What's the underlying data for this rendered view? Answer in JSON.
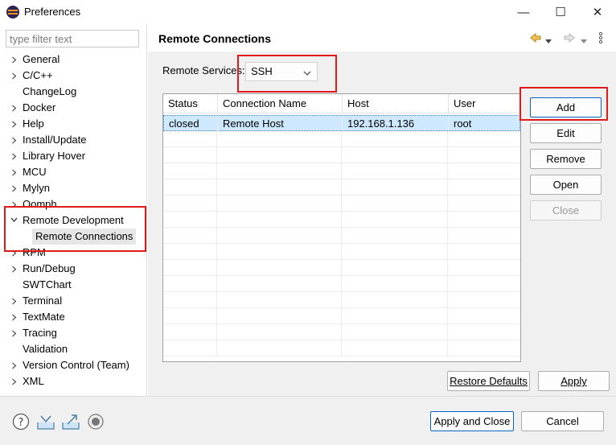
{
  "window": {
    "title": "Preferences",
    "minimize": "—",
    "maximize": "☐",
    "close": "✕"
  },
  "filter": {
    "placeholder": "type filter text"
  },
  "tree": [
    {
      "label": "General",
      "expandable": true
    },
    {
      "label": "C/C++",
      "expandable": true
    },
    {
      "label": "ChangeLog",
      "expandable": false
    },
    {
      "label": "Docker",
      "expandable": true
    },
    {
      "label": "Help",
      "expandable": true
    },
    {
      "label": "Install/Update",
      "expandable": true
    },
    {
      "label": "Library Hover",
      "expandable": true
    },
    {
      "label": "MCU",
      "expandable": true
    },
    {
      "label": "Mylyn",
      "expandable": true
    },
    {
      "label": "Oomph",
      "expandable": true
    },
    {
      "label": "Remote Development",
      "expandable": true,
      "expanded": true
    },
    {
      "label": "Remote Connections",
      "child": true,
      "selected": true
    },
    {
      "label": "RPM",
      "expandable": true
    },
    {
      "label": "Run/Debug",
      "expandable": true
    },
    {
      "label": "SWTChart",
      "expandable": false
    },
    {
      "label": "Terminal",
      "expandable": true
    },
    {
      "label": "TextMate",
      "expandable": true
    },
    {
      "label": "Tracing",
      "expandable": true
    },
    {
      "label": "Validation",
      "expandable": false
    },
    {
      "label": "Version Control (Team)",
      "expandable": true
    },
    {
      "label": "XML",
      "expandable": true
    }
  ],
  "page": {
    "title": "Remote Connections",
    "remote_services_label": "Remote Services:",
    "remote_services_value": "SSH"
  },
  "table": {
    "columns": [
      "Status",
      "Connection Name",
      "Host",
      "User"
    ],
    "rows": [
      [
        "closed",
        "Remote Host",
        "192.168.1.136",
        "root"
      ]
    ]
  },
  "buttons": {
    "add": "Add",
    "edit": "Edit",
    "remove": "Remove",
    "open": "Open",
    "close": "Close",
    "restore_defaults": "Restore Defaults",
    "apply": "Apply",
    "apply_and_close": "Apply and Close",
    "cancel": "Cancel"
  },
  "colors": {
    "highlight": "#e0191b",
    "selection": "#cde8ff",
    "accent": "#0a64c6"
  }
}
